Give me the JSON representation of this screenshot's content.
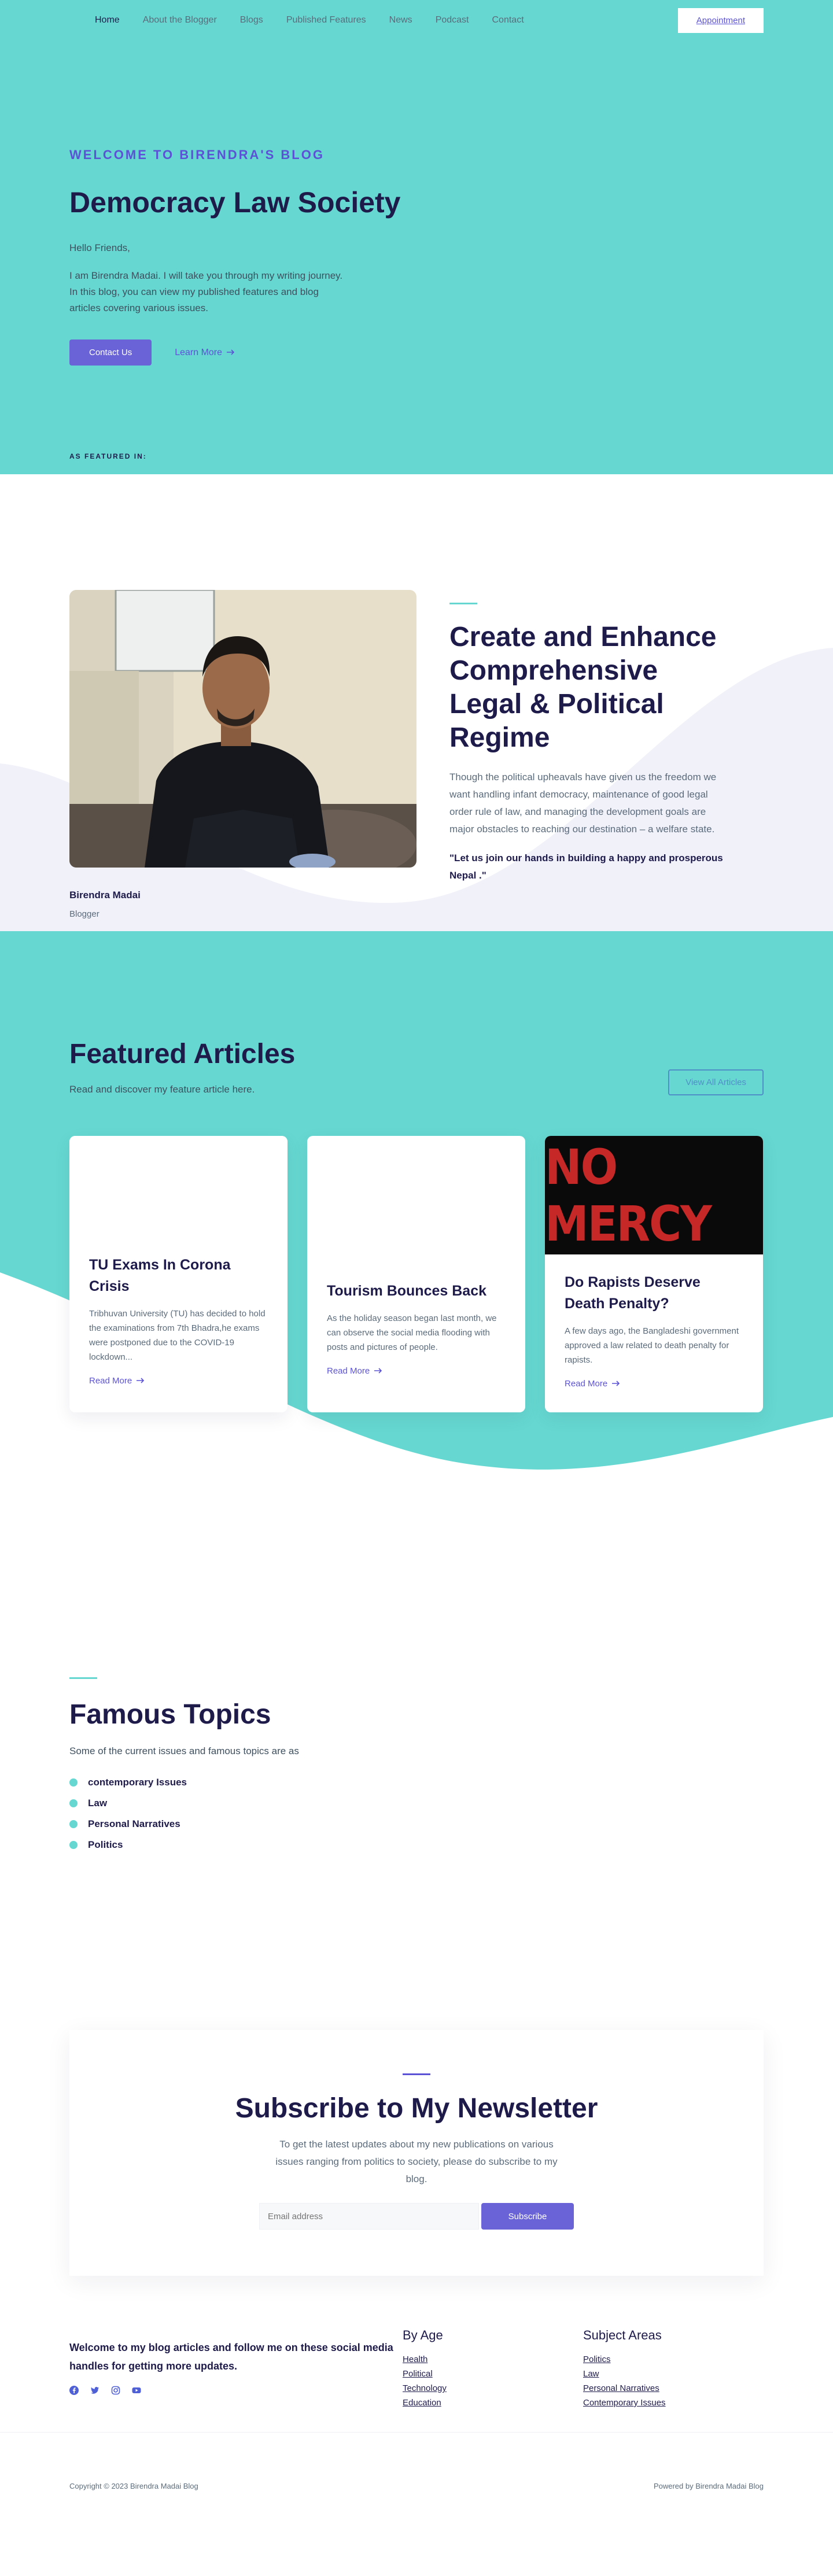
{
  "nav": {
    "links": [
      "Home",
      "About the Blogger",
      "Blogs",
      "Published Features",
      "News",
      "Podcast",
      "Contact"
    ],
    "appointment": "Appointment"
  },
  "hero": {
    "eyebrow": "WELCOME TO BIRENDRA'S BLOG",
    "title": "Democracy Law Society",
    "hello": "Hello Friends,",
    "description": "I am Birendra Madai. I will take you through my writing journey. In this blog, you can view my published features and blog articles covering various issues.",
    "contact_button": "Contact Us",
    "learn_more": "Learn More",
    "featured_in": "AS FEATURED IN:"
  },
  "about": {
    "name": "Birendra Madai",
    "role": "Blogger",
    "title": "Create and Enhance Comprehensive Legal & Political Regime",
    "description": "Though the political upheavals have given us the freedom we want handling infant democracy, maintenance of good legal order rule of law, and managing the development goals are major obstacles to reaching our destination – a welfare state.",
    "quote": "\"Let us join our hands in building a happy and prosperous Nepal .\""
  },
  "articles": {
    "title": "Featured Articles",
    "subtitle": "Read and discover my feature article here.",
    "view_all": "View All Articles",
    "items": [
      {
        "title": "TU Exams In Corona Crisis",
        "text": "Tribhuvan University (TU) has decided to hold the examinations from 7th Bhadra,he exams were postponed due to the COVID-19 lockdown...",
        "link": "Read More"
      },
      {
        "title": "Tourism Bounces Back",
        "text": "As the holiday season began last month, we can observe the social media flooding with posts and pictures of people.",
        "link": "Read More"
      },
      {
        "title": "Do Rapists Deserve Death Penalty?",
        "text": "A few days ago, the Bangladeshi government approved a law related to death penalty for rapists.",
        "link": "Read More",
        "image_text": "NO MERCY"
      }
    ]
  },
  "topics": {
    "title": "Famous Topics",
    "subtitle": "Some of the current issues and famous topics are as",
    "items": [
      "contemporary Issues",
      "Law",
      "Personal Narratives",
      "Politics"
    ]
  },
  "newsletter": {
    "title": "Subscribe to My Newsletter",
    "description": "To get the latest updates about my new publications on various issues ranging from politics to society, please do subscribe to my blog.",
    "placeholder": "Email address",
    "button": "Subscribe"
  },
  "footer": {
    "tagline": "Welcome to my blog articles and follow me on these social media handles for getting more updates.",
    "socials": [
      "facebook-icon",
      "twitter-icon",
      "instagram-icon",
      "youtube-icon"
    ],
    "by_age": {
      "title": "By Age",
      "links": [
        "Health",
        "Political",
        "Technology",
        "Education"
      ]
    },
    "subject_areas": {
      "title": "Subject Areas",
      "links": [
        "Politics",
        "Law",
        "Personal Narratives",
        "Contemporary Issues"
      ]
    },
    "copyright": "Copyright © 2023 Birendra Madai Blog",
    "powered": "Powered by Birendra Madai Blog"
  },
  "colors": {
    "teal": "#66d8d1",
    "accent": "#6a63d8",
    "heading": "#1e1b4b",
    "lavender": "#f1f1f9"
  }
}
